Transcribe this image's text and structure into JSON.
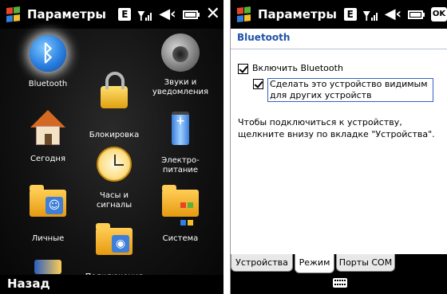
{
  "left": {
    "title": "Параметры",
    "status": {
      "edge": "E",
      "speaker": "◀‹",
      "close": "✕"
    },
    "tiles": [
      {
        "label": "Bluetooth",
        "icon": "bluetooth-icon"
      },
      {
        "label": "Звуки и\nуведомления",
        "icon": "speaker-icon"
      },
      {
        "label": "Блокировка",
        "icon": "lock-icon"
      },
      {
        "label": "Сегодня",
        "icon": "today-house-icon"
      },
      {
        "label": "Электро-\nпитание",
        "icon": "power-battery-icon"
      },
      {
        "label": "Часы и сигналы",
        "icon": "clock-alarm-icon"
      },
      {
        "label": "Личные",
        "icon": "personal-folder-icon"
      },
      {
        "label": "Система",
        "icon": "system-folder-icon"
      },
      {
        "label": "Подключения",
        "icon": "connections-folder-icon"
      }
    ],
    "softkey_left": "Назад"
  },
  "right": {
    "title": "Параметры",
    "status": {
      "edge": "E",
      "speaker": "◀‹",
      "ok": "OK"
    },
    "page_title": "Bluetooth",
    "enable_bluetooth": {
      "label": "Включить Bluetooth",
      "checked": true
    },
    "make_visible": {
      "label": "Сделать это устройство видимым для других устройств",
      "checked": true
    },
    "info": "Чтобы подключиться к устройству, щелкните внизу по вкладке \"Устройства\".",
    "tabs": [
      {
        "label": "Устройства",
        "active": false
      },
      {
        "label": "Режим",
        "active": true
      },
      {
        "label": "Порты COM",
        "active": false
      }
    ]
  }
}
